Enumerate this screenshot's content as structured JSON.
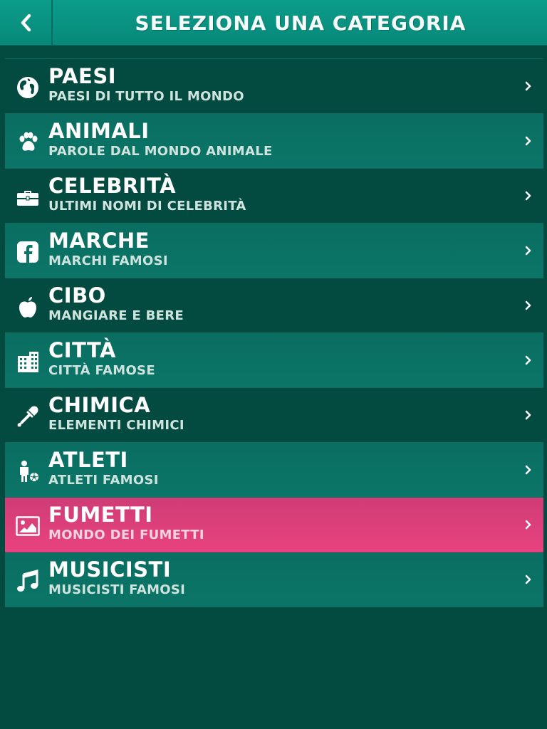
{
  "header": {
    "title": "SELEZIONA UNA CATEGORIA",
    "back_icon": "chevron-left-icon"
  },
  "categories": [
    {
      "id": "paesi",
      "label": "PAESI",
      "subtitle": "PAESI DI TUTTO IL MONDO",
      "icon": "globe-icon"
    },
    {
      "id": "animali",
      "label": "ANIMALI",
      "subtitle": "PAROLE DAL MONDO ANIMALE",
      "icon": "paw-icon"
    },
    {
      "id": "celebrita",
      "label": "CELEBRITÀ",
      "subtitle": "ULTIMI NOMI DI CELEBRITÀ",
      "icon": "briefcase-icon"
    },
    {
      "id": "marche",
      "label": "MARCHE",
      "subtitle": "MARCHI FAMOSI",
      "icon": "facebook-icon"
    },
    {
      "id": "cibo",
      "label": "CIBO",
      "subtitle": "MANGIARE E BERE",
      "icon": "apple-icon"
    },
    {
      "id": "citta",
      "label": "CITTÀ",
      "subtitle": "CITTÀ FAMOSE",
      "icon": "buildings-icon"
    },
    {
      "id": "chimica",
      "label": "CHIMICA",
      "subtitle": "ELEMENTI CHIMICI",
      "icon": "eyedropper-icon"
    },
    {
      "id": "atleti",
      "label": "ATLETI",
      "subtitle": "ATLETI FAMOSI",
      "icon": "athlete-icon"
    },
    {
      "id": "fumetti",
      "label": "FUMETTI",
      "subtitle": "MONDO DEI FUMETTI",
      "icon": "picture-icon"
    },
    {
      "id": "musicisti",
      "label": "MUSICISTI",
      "subtitle": "MUSICISTI FAMOSI",
      "icon": "music-note-icon"
    }
  ],
  "selected_category": "fumetti",
  "colors": {
    "background": "#034b40",
    "header": "#0c9c89",
    "row_alt": "#0a6e61",
    "selected": "#e8437e",
    "text": "#ffffff",
    "subtext": "#cfe4de"
  }
}
